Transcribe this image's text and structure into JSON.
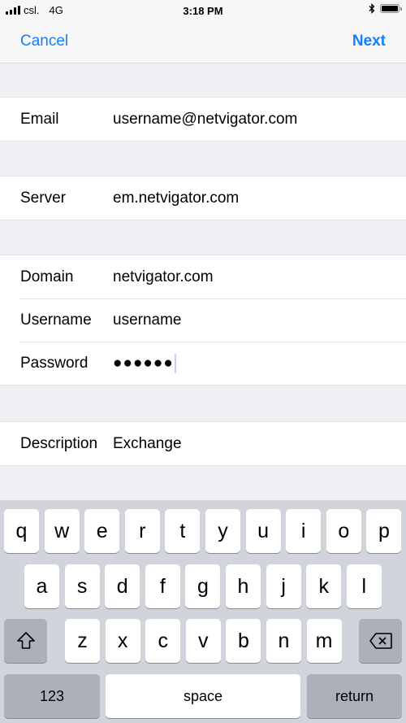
{
  "status_bar": {
    "carrier": "csl.",
    "network": "4G",
    "time": "3:18 PM",
    "icons": [
      "signal-icon",
      "bluetooth-icon",
      "battery-icon"
    ]
  },
  "nav": {
    "cancel_label": "Cancel",
    "next_label": "Next",
    "accent_color": "#157efb"
  },
  "form": {
    "email": {
      "label": "Email",
      "value": "username@netvigator.com"
    },
    "server": {
      "label": "Server",
      "value": "em.netvigator.com"
    },
    "domain": {
      "label": "Domain",
      "value": "netvigator.com"
    },
    "username": {
      "label": "Username",
      "value": "username"
    },
    "password": {
      "label": "Password",
      "value": "●●●●●●"
    },
    "description": {
      "label": "Description",
      "value": "Exchange"
    }
  },
  "keyboard": {
    "row1": [
      "q",
      "w",
      "e",
      "r",
      "t",
      "y",
      "u",
      "i",
      "o",
      "p"
    ],
    "row2": [
      "a",
      "s",
      "d",
      "f",
      "g",
      "h",
      "j",
      "k",
      "l"
    ],
    "row3": [
      "z",
      "x",
      "c",
      "v",
      "b",
      "n",
      "m"
    ],
    "numbers_label": "123",
    "space_label": "space",
    "return_label": "return"
  }
}
